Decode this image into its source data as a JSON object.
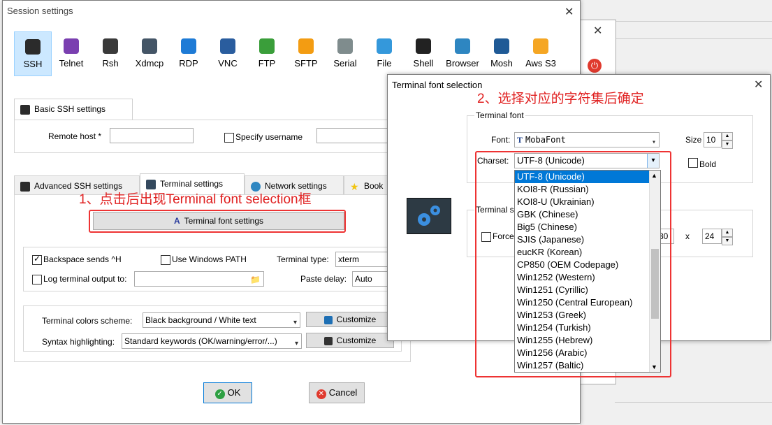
{
  "session_window": {
    "title": "Session settings",
    "protocols": [
      {
        "label": "SSH",
        "icon": "ssh-icon",
        "color": "#2b2b2b"
      },
      {
        "label": "Telnet",
        "icon": "telnet-icon",
        "color": "#7a3fb0"
      },
      {
        "label": "Rsh",
        "icon": "rsh-icon",
        "color": "#3a3a3a"
      },
      {
        "label": "Xdmcp",
        "icon": "xdmcp-icon",
        "color": "#445566"
      },
      {
        "label": "RDP",
        "icon": "rdp-icon",
        "color": "#1e7bd6"
      },
      {
        "label": "VNC",
        "icon": "vnc-icon",
        "color": "#2a5d9e"
      },
      {
        "label": "FTP",
        "icon": "ftp-icon",
        "color": "#3a9e3a"
      },
      {
        "label": "SFTP",
        "icon": "sftp-icon",
        "color": "#f39c12"
      },
      {
        "label": "Serial",
        "icon": "serial-icon",
        "color": "#7f8c8d"
      },
      {
        "label": "File",
        "icon": "file-icon",
        "color": "#3498db"
      },
      {
        "label": "Shell",
        "icon": "shell-icon",
        "color": "#222222"
      },
      {
        "label": "Browser",
        "icon": "browser-icon",
        "color": "#2e86c1"
      },
      {
        "label": "Mosh",
        "icon": "mosh-icon",
        "color": "#1f5a96"
      },
      {
        "label": "Aws S3",
        "icon": "aws-s3-icon",
        "color": "#f5a623"
      }
    ],
    "basic_tab": "Basic SSH settings",
    "remote_host_label": "Remote host *",
    "remote_host_value": "",
    "specify_username_label": "Specify username",
    "username_value": "",
    "tabs": [
      {
        "label": "Advanced SSH settings"
      },
      {
        "label": "Terminal settings"
      },
      {
        "label": "Network settings"
      },
      {
        "label": "Book"
      }
    ],
    "terminal_font_button": "Terminal font settings",
    "backspace_label": "Backspace sends ^H",
    "use_windows_path_label": "Use Windows PATH",
    "terminal_type_label": "Terminal type:",
    "terminal_type_value": "xterm",
    "log_output_label": "Log terminal output to:",
    "paste_delay_label": "Paste delay:",
    "paste_delay_value": "Auto",
    "colors_scheme_label": "Terminal colors scheme:",
    "colors_scheme_value": "Black background / White text",
    "syntax_label": "Syntax highlighting:",
    "syntax_value": "Standard keywords (OK/warning/error/...)",
    "customize_label": "Customize",
    "ok_label": "OK",
    "cancel_label": "Cancel"
  },
  "font_dialog": {
    "title": "Terminal font selection",
    "group_font": "Terminal font",
    "font_label": "Font:",
    "font_value": "MobaFont",
    "size_label": "Size",
    "size_value": "10",
    "charset_label": "Charset:",
    "charset_value": "UTF-8 (Unicode)",
    "bold_label": "Bold",
    "group_size": "Terminal s",
    "force_label": "Force",
    "cols_value": "80",
    "x_label": "x",
    "rows_value": "24",
    "charsets": [
      "UTF-8 (Unicode)",
      "KOI8-R (Russian)",
      "KOI8-U (Ukrainian)",
      "GBK (Chinese)",
      "Big5 (Chinese)",
      "SJIS (Japanese)",
      "eucKR (Korean)",
      "CP850 (OEM Codepage)",
      "Win1252 (Western)",
      "Win1251 (Cyrillic)",
      "Win1250 (Central European)",
      "Win1253 (Greek)",
      "Win1254 (Turkish)",
      "Win1255 (Hebrew)",
      "Win1256 (Arabic)",
      "Win1257 (Baltic)"
    ]
  },
  "annotations": {
    "step1": "1、点击后出现Terminal font selection框",
    "step2": "2、选择对应的字符集后确定"
  }
}
